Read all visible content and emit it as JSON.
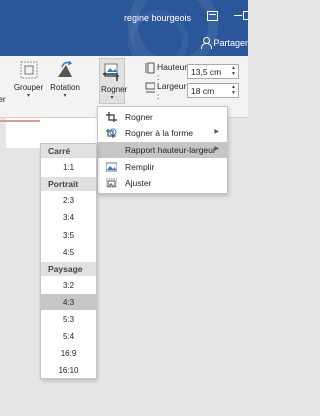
{
  "titlebar": {
    "username": "regine bourgeois",
    "share_label": "Partager"
  },
  "ribbon": {
    "buttons": [
      {
        "label": "er"
      },
      {
        "label": "Grouper"
      },
      {
        "label": "Rotation"
      },
      {
        "label": "Rogner"
      }
    ],
    "height_label": "Hauteur :",
    "height_value": "13,5 cm",
    "width_label": "Largeur :",
    "width_value": "18 cm"
  },
  "crop_menu": {
    "items": [
      {
        "label": "Rogner",
        "icon": "crop-icon"
      },
      {
        "label": "Rogner à la forme",
        "icon": "crop-shape-icon",
        "has_submenu": true
      },
      {
        "label": "Rapport hauteur-largeur",
        "has_submenu": true,
        "highlighted": true
      },
      {
        "label": "Remplir",
        "icon": "fill-icon"
      },
      {
        "label": "Ajuster",
        "icon": "fit-icon"
      }
    ]
  },
  "ratio_submenu": {
    "groups": [
      {
        "title": "Carré",
        "items": [
          "1:1"
        ]
      },
      {
        "title": "Portrait",
        "items": [
          "2:3",
          "3:4",
          "3:5",
          "4:5"
        ]
      },
      {
        "title": "Paysage",
        "items": [
          "3:2",
          "4:3",
          "5:3",
          "5:4",
          "16:9",
          "16:10"
        ]
      }
    ],
    "selected": "4:3"
  }
}
